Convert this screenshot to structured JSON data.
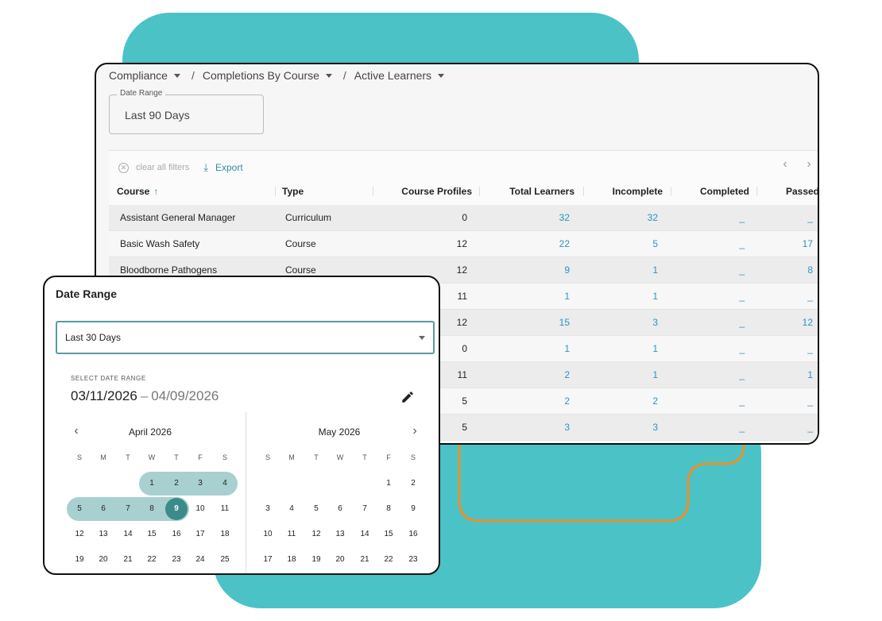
{
  "breadcrumb": [
    {
      "label": "Compliance"
    },
    {
      "label": "Completions By Course"
    },
    {
      "label": "Active Learners"
    }
  ],
  "breadcrumb_separator": "/",
  "filter": {
    "legend": "Date Range",
    "value": "Last 90 Days"
  },
  "toolbar": {
    "clear_label": "clear all filters",
    "export_label": "Export"
  },
  "table": {
    "columns": [
      "Course",
      "Type",
      "Course Profiles",
      "Total Learners",
      "Incomplete",
      "Completed",
      "Passed"
    ],
    "rows": [
      [
        "Assistant General Manager",
        "Curriculum",
        "0",
        "32",
        "32",
        "_",
        "_"
      ],
      [
        "Basic Wash Safety",
        "Course",
        "12",
        "22",
        "5",
        "_",
        "17"
      ],
      [
        "Bloodborne Pathogens",
        "Course",
        "12",
        "9",
        "1",
        "_",
        "8"
      ],
      [
        "",
        "",
        "11",
        "1",
        "1",
        "_",
        "_"
      ],
      [
        "",
        "",
        "12",
        "15",
        "3",
        "_",
        "12"
      ],
      [
        "",
        "",
        "0",
        "1",
        "1",
        "_",
        "_"
      ],
      [
        "",
        "",
        "11",
        "2",
        "1",
        "_",
        "1"
      ],
      [
        "",
        "",
        "5",
        "2",
        "2",
        "_",
        "_"
      ],
      [
        "",
        "",
        "5",
        "3",
        "3",
        "_",
        "_"
      ]
    ]
  },
  "date_dialog": {
    "title": "Date Range",
    "select_value": "Last 30 Days",
    "select_label": "SELECT DATE RANGE",
    "range_start": "03/11/2026",
    "range_dash": "–",
    "range_end": "04/09/2026",
    "weekdays": [
      "S",
      "M",
      "T",
      "W",
      "T",
      "F",
      "S"
    ],
    "months": [
      {
        "title": "April 2026",
        "weeks": [
          [
            "",
            "",
            "",
            "1",
            "2",
            "3",
            "4"
          ],
          [
            "5",
            "6",
            "7",
            "8",
            "9",
            "10",
            "11"
          ],
          [
            "12",
            "13",
            "14",
            "15",
            "16",
            "17",
            "18"
          ],
          [
            "19",
            "20",
            "21",
            "22",
            "23",
            "24",
            "25"
          ]
        ]
      },
      {
        "title": "May 2026",
        "weeks": [
          [
            "",
            "",
            "",
            "",
            "",
            "1",
            "2"
          ],
          [
            "3",
            "4",
            "5",
            "6",
            "7",
            "8",
            "9"
          ],
          [
            "10",
            "11",
            "12",
            "13",
            "14",
            "15",
            "16"
          ],
          [
            "17",
            "18",
            "19",
            "20",
            "21",
            "22",
            "23"
          ]
        ]
      }
    ],
    "selected_day": "9",
    "in_range_days": [
      "1",
      "2",
      "3",
      "4",
      "5",
      "6",
      "7",
      "8",
      "9"
    ]
  },
  "colors": {
    "teal_background": "#4ac2c6",
    "accent_orange": "#e8912d",
    "range_fill": "#a8d0d0",
    "selected_day": "#3d8a8a",
    "link_blue": "#2a93c8"
  },
  "icons": {
    "sort": "arrow-up-icon",
    "clear": "close-circle-icon",
    "export": "download-icon",
    "edit": "pencil-icon",
    "prev": "chevron-left-icon",
    "next": "chevron-right-icon"
  }
}
